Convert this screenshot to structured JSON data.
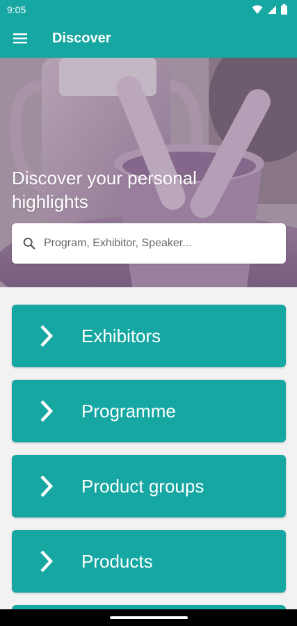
{
  "status_bar": {
    "time": "9:05",
    "icons": [
      "wifi-icon",
      "signal-icon",
      "battery-icon"
    ]
  },
  "app_bar": {
    "title": "Discover",
    "menu_icon": "hamburger-menu-icon"
  },
  "hero": {
    "headline": "Discover your personal highlights",
    "search_placeholder": "Program, Exhibitor, Speaker...",
    "search_value": ""
  },
  "menu": {
    "items": [
      {
        "label": "Exhibitors",
        "icon": "chevron-right-icon"
      },
      {
        "label": "Programme",
        "icon": "chevron-right-icon"
      },
      {
        "label": "Product groups",
        "icon": "chevron-right-icon"
      },
      {
        "label": "Products",
        "icon": "chevron-right-icon"
      }
    ]
  },
  "colors": {
    "primary": "#17a7a2",
    "background": "#f2f2f2",
    "text_on_primary": "#ffffff"
  }
}
